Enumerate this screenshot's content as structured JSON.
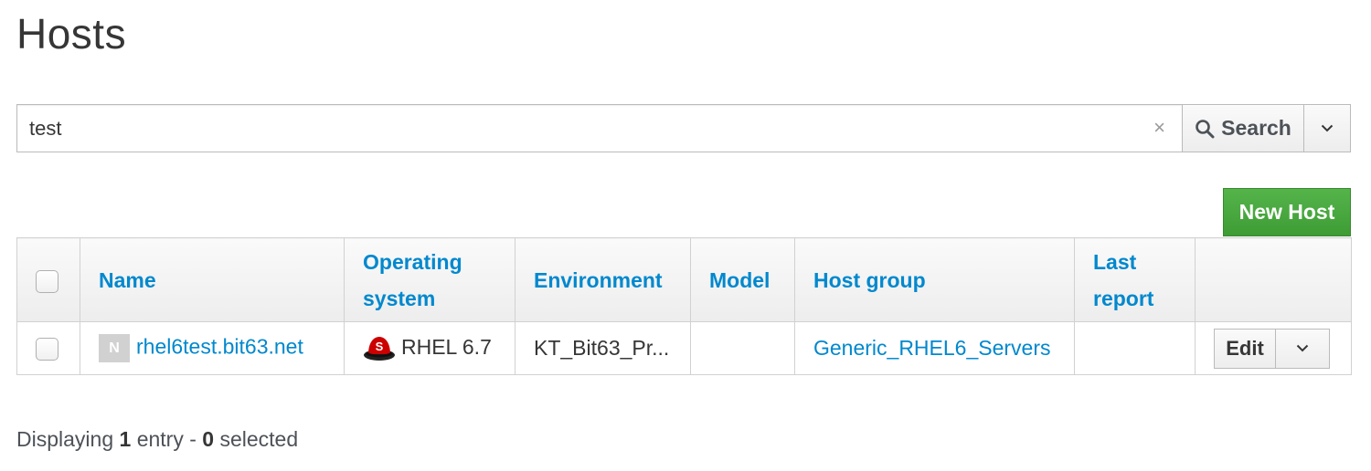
{
  "page": {
    "title": "Hosts"
  },
  "search": {
    "value": "test",
    "clear_symbol": "×",
    "button_label": "Search"
  },
  "toolbar": {
    "new_host_label": "New Host"
  },
  "table": {
    "columns": {
      "name": "Name",
      "os": "Operating system",
      "environment": "Environment",
      "model": "Model",
      "host_group": "Host group",
      "last_report": "Last report"
    },
    "rows": [
      {
        "badge": "N",
        "name": "rhel6test.bit63.net",
        "os": "RHEL 6.7",
        "environment": "KT_Bit63_Pr...",
        "model": "",
        "host_group": "Generic_RHEL6_Servers",
        "last_report": "",
        "edit_label": "Edit"
      }
    ]
  },
  "footer": {
    "prefix": "Displaying",
    "count": "1",
    "mid": "entry -",
    "selected": "0",
    "suffix": "selected"
  },
  "colors": {
    "link": "#0088ce",
    "new_host_green": "#3f9c35",
    "os_logo_red": "#cc0000"
  },
  "icons": [
    "search-icon",
    "close-icon",
    "chevron-down-icon",
    "redhat-logo-icon"
  ]
}
